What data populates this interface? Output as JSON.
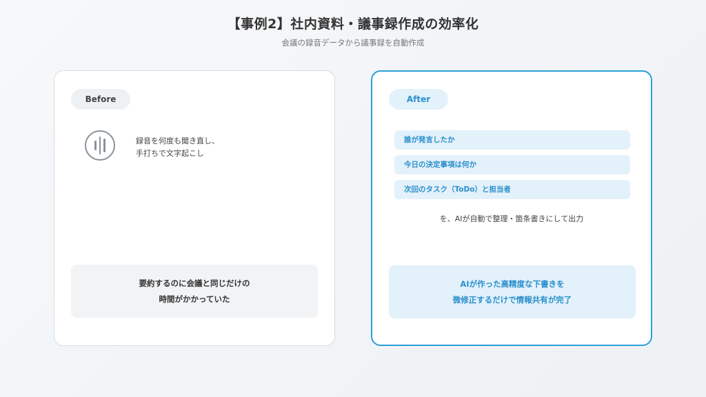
{
  "header": {
    "title": "【事例2】社内資料・議事録作成の効率化",
    "subtitle": "会議の録音データから議事録を自動作成"
  },
  "before": {
    "label": "Before",
    "icon": "voice-waveform-icon",
    "description_line1": "録音を何度も聞き直し、",
    "description_line2": "手打ちで文字起こし",
    "summary_line1": "要約するのに会議と同じだけの",
    "summary_line2": "時間がかかっていた"
  },
  "after": {
    "label": "After",
    "points": [
      "誰が発言したか",
      "今日の決定事項は何か",
      "次回のタスク（ToDo）と担当者"
    ],
    "note": "を、AIが自動で整理・箇条書きにして出力",
    "summary_line1": "AIが作った高精度な下書きを",
    "summary_line2": "微修正するだけで情報共有が完了"
  },
  "colors": {
    "accent": "#2a9fd6",
    "accent_text": "#2a8fcc",
    "accent_light": "#e3f1fb",
    "neutral_light": "#f1f3f5"
  }
}
